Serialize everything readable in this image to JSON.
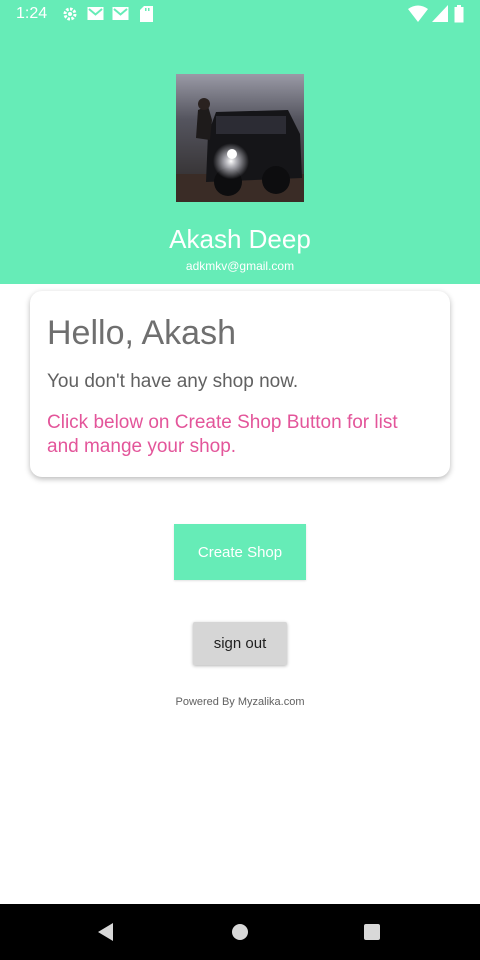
{
  "status_bar": {
    "time": "1:24",
    "icons": [
      "gear-icon",
      "gmail-icon",
      "gmail-icon",
      "sd-card-icon",
      "wifi-icon",
      "cell-signal-icon",
      "battery-icon"
    ]
  },
  "profile": {
    "name": "Akash Deep",
    "email": "adkmkv@gmail.com"
  },
  "card": {
    "greeting": "Hello, Akash",
    "message": "You don't have any shop now.",
    "hint": "Click below on Create Shop Button for list and mange your shop."
  },
  "actions": {
    "create_shop_label": "Create Shop",
    "sign_out_label": "sign out"
  },
  "footer": {
    "powered_by": "Powered By Myzalika.com"
  },
  "colors": {
    "accent": "#66ecb7",
    "hint_pink": "#e3559a",
    "button_grey": "#d6d6d6"
  }
}
